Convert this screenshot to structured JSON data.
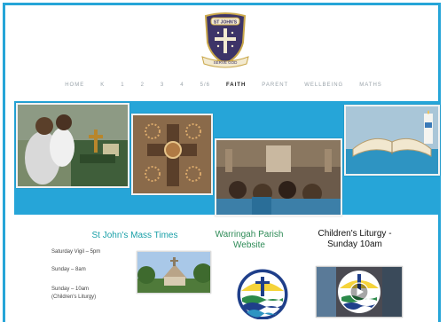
{
  "logo": {
    "banner_text": "ST JOHN'S",
    "motto": "SERVE GOD"
  },
  "nav": {
    "items": [
      {
        "label": "HOME"
      },
      {
        "label": "K"
      },
      {
        "label": "1"
      },
      {
        "label": "2"
      },
      {
        "label": "3"
      },
      {
        "label": "4"
      },
      {
        "label": "5/6"
      },
      {
        "label": "FAITH"
      },
      {
        "label": "PARENT"
      },
      {
        "label": "WELLBEING"
      },
      {
        "label": "MATHS"
      }
    ],
    "active": "FAITH"
  },
  "banner": {
    "color": "#26a5d8"
  },
  "mass_times": {
    "title": "St John's Mass Times",
    "saturday": "Saturday Vigil – 5pm",
    "sunday8": "Sunday – 8am",
    "sunday10": "Sunday – 10am",
    "sunday10_note": "(Children's Liturgy)"
  },
  "parish": {
    "title_line1": "Warringah Parish",
    "title_line2": "Website"
  },
  "liturgy": {
    "title_line1": "Children's Liturgy -",
    "title_line2": "Sunday 10am"
  },
  "icons": [
    "school-crest-icon",
    "play-icon"
  ]
}
